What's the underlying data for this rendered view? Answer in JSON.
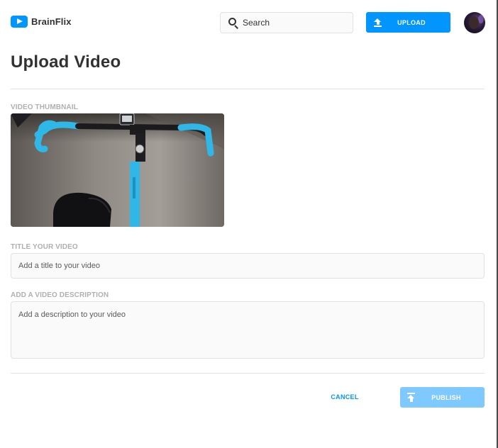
{
  "header": {
    "brand": "BrainFlix",
    "search": {
      "placeholder": "Search",
      "value": ""
    },
    "upload_label": "UPLOAD",
    "avatar_icon": "user-avatar"
  },
  "main": {
    "title": "Upload Video",
    "thumbnail": {
      "label": "VIDEO THUMBNAIL",
      "image_subject": "bicycle-handlebars-riding-on-road"
    },
    "title_field": {
      "label": "TITLE YOUR VIDEO",
      "placeholder": "Add a title to your video",
      "value": ""
    },
    "description_field": {
      "label": "ADD A VIDEO DESCRIPTION",
      "placeholder": "Add a description to your video",
      "value": ""
    }
  },
  "actions": {
    "cancel_label": "CANCEL",
    "publish_label": "PUBLISH"
  },
  "colors": {
    "accent": "#0095ff",
    "accent_disabled": "#7ec9ff",
    "label_gray": "#afafaf",
    "text_dark": "#323232",
    "border": "#e1e1e1",
    "field_bg": "#fafafa",
    "handlebar_blue": "#2fb7e8"
  },
  "icons": {
    "logo": "play-icon",
    "search": "search-icon",
    "upload": "upload-icon",
    "publish": "publish-icon"
  }
}
